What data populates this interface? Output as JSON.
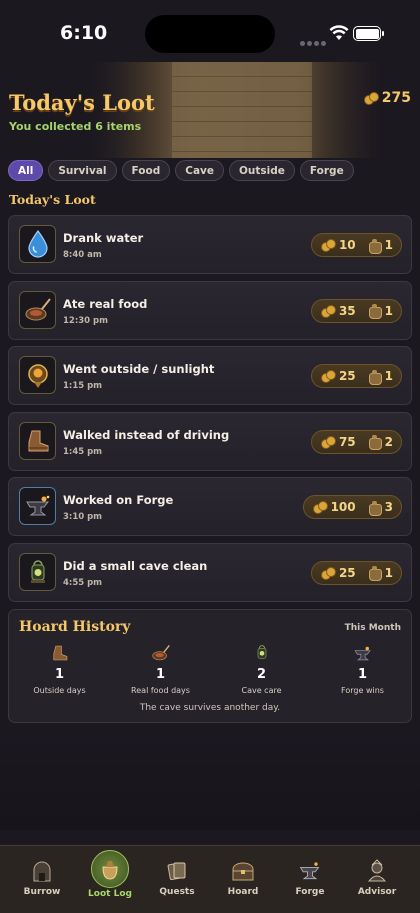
{
  "status_bar": {
    "time": "6:10"
  },
  "header": {
    "title": "Today's Loot",
    "subtitle": "You collected 6 items",
    "coins": "275"
  },
  "filters": [
    {
      "label": "All",
      "active": true
    },
    {
      "label": "Survival"
    },
    {
      "label": "Food"
    },
    {
      "label": "Cave"
    },
    {
      "label": "Outside"
    },
    {
      "label": "Forge"
    }
  ],
  "section_title": "Today's Loot",
  "loot": [
    {
      "title": "Drank water",
      "time": "8:40 am",
      "coins": "10",
      "items": "1",
      "icon": "water-drop-icon"
    },
    {
      "title": "Ate real food",
      "time": "12:30 pm",
      "coins": "35",
      "items": "1",
      "icon": "food-pan-icon"
    },
    {
      "title": "Went outside / sunlight",
      "time": "1:15 pm",
      "coins": "25",
      "items": "1",
      "icon": "sun-amulet-icon"
    },
    {
      "title": "Walked instead of driving",
      "time": "1:45 pm",
      "coins": "75",
      "items": "2",
      "icon": "boot-icon"
    },
    {
      "title": "Worked on Forge",
      "time": "3:10 pm",
      "coins": "100",
      "items": "3",
      "icon": "anvil-icon"
    },
    {
      "title": "Did a small cave clean",
      "time": "4:55 pm",
      "coins": "25",
      "items": "1",
      "icon": "lantern-icon"
    }
  ],
  "hoard": {
    "title": "Hoard History",
    "period": "This Month",
    "stats": [
      {
        "value": "1",
        "label": "Outside days",
        "icon": "boot-icon"
      },
      {
        "value": "1",
        "label": "Real food days",
        "icon": "food-pan-icon"
      },
      {
        "value": "2",
        "label": "Cave care",
        "icon": "lantern-icon"
      },
      {
        "value": "1",
        "label": "Forge wins",
        "icon": "anvil-icon"
      }
    ],
    "footer": "The cave survives another day."
  },
  "tabs": [
    {
      "label": "Burrow",
      "icon": "burrow-icon"
    },
    {
      "label": "Loot Log",
      "icon": "loot-bag-icon",
      "active": true
    },
    {
      "label": "Quests",
      "icon": "quest-cards-icon"
    },
    {
      "label": "Hoard",
      "icon": "treasure-chest-icon"
    },
    {
      "label": "Forge",
      "icon": "anvil-icon"
    },
    {
      "label": "Advisor",
      "icon": "advisor-icon"
    }
  ],
  "colors": {
    "accent_gold": "#f5c86a",
    "accent_green": "#a6d36a",
    "active_chip": "#5e4aa8"
  }
}
